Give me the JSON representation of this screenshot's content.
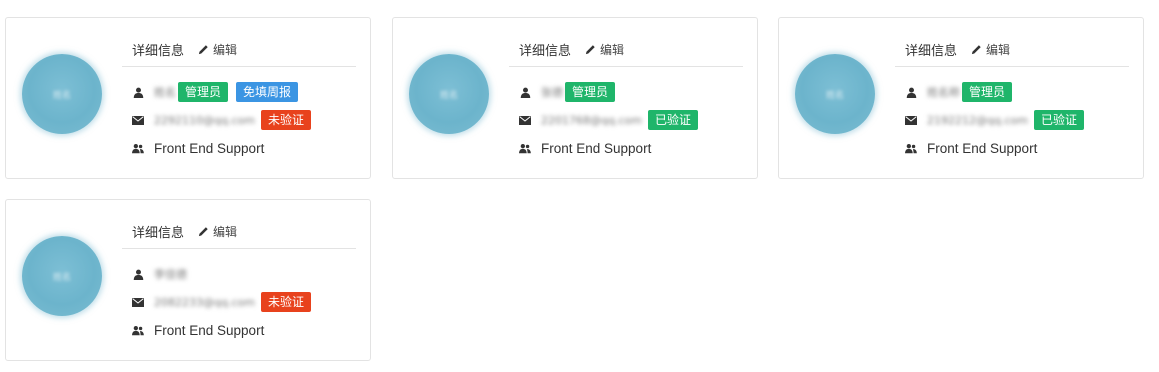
{
  "colors": {
    "green_badge": "#1fb56a",
    "blue_badge": "#3b95e3",
    "red_badge": "#e8421d",
    "avatar": "#6cb4cc",
    "border": "#e3e3e3"
  },
  "icons": {
    "edit": "pencil-icon",
    "user": "user-icon",
    "email": "envelope-icon",
    "department": "group-icon"
  },
  "cards": [
    {
      "header_title": "详细信息",
      "edit_label": "编辑",
      "avatar_text": "姓名",
      "name": "姓名",
      "name_badges": [
        "管理员",
        "免填周报"
      ],
      "email": "2292110@qq.com",
      "verify_badge": "未验证",
      "verify_color": "red",
      "department": "Front End Support"
    },
    {
      "header_title": "详细信息",
      "edit_label": "编辑",
      "avatar_text": "姓名",
      "name": "张德",
      "name_badges": [
        "管理员"
      ],
      "email": "2201768@qq.com",
      "verify_badge": "已验证",
      "verify_color": "green",
      "department": "Front End Support"
    },
    {
      "header_title": "详细信息",
      "edit_label": "编辑",
      "avatar_text": "姓名",
      "name": "姓名称",
      "name_badges": [
        "管理员"
      ],
      "email": "2192212@qq.com",
      "verify_badge": "已验证",
      "verify_color": "green",
      "department": "Front End Support"
    },
    {
      "header_title": "详细信息",
      "edit_label": "编辑",
      "avatar_text": "姓名",
      "name": "李佳德",
      "name_badges": [],
      "email": "2082233@qq.com",
      "verify_badge": "未验证",
      "verify_color": "red",
      "department": "Front End Support"
    }
  ]
}
